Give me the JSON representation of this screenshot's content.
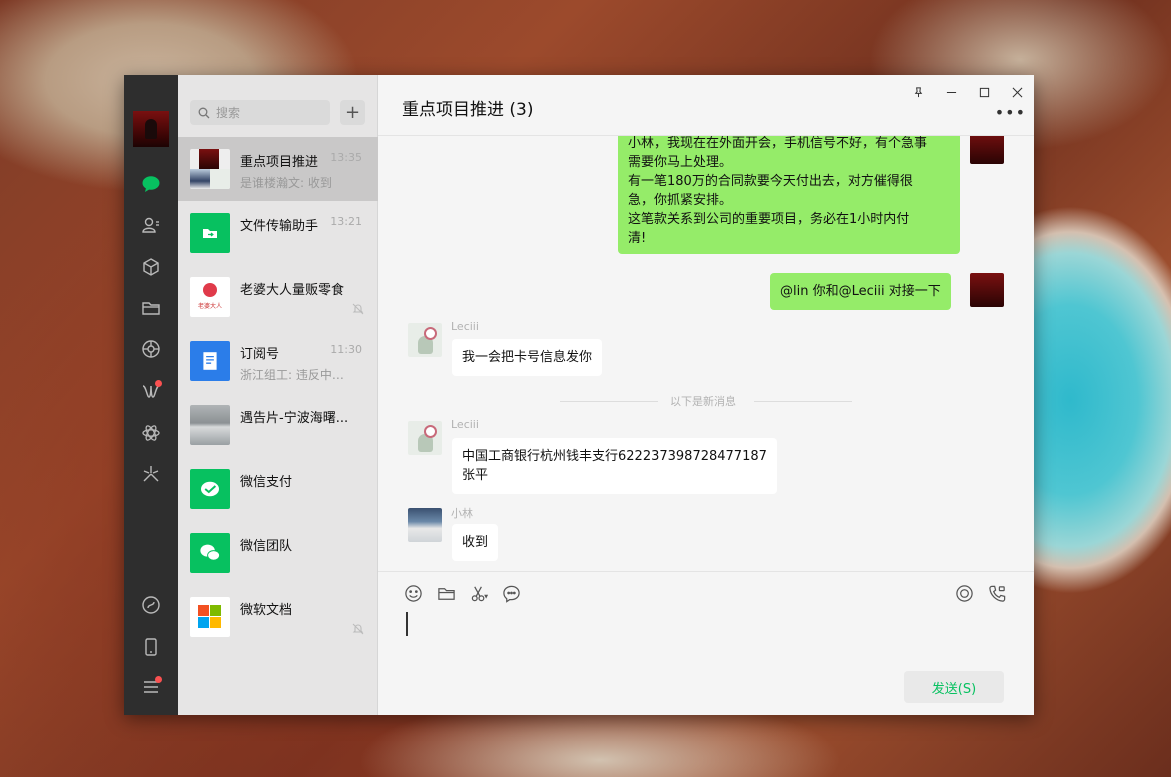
{
  "sidebar": {
    "icons": [
      "chat-icon",
      "contacts-icon",
      "favorites-icon",
      "files-icon",
      "moments-icon",
      "channels-icon",
      "search-apps-icon",
      "mini-programs-icon",
      "phone-icon",
      "menu-icon"
    ]
  },
  "list": {
    "search_placeholder": "搜索",
    "add_label": "+",
    "conversations": [
      {
        "name": "重点项目推进",
        "time": "13:35",
        "preview": "是谁楼瀚文: 收到"
      },
      {
        "name": "文件传输助手",
        "time": "13:21",
        "preview": ""
      },
      {
        "name": "老婆大人量贩零食",
        "time": "",
        "preview": ""
      },
      {
        "name": "订阅号",
        "time": "11:30",
        "preview": "浙江组工: 违反中央..."
      },
      {
        "name": "遇告片-宁波海曙...",
        "time": "",
        "preview": ""
      },
      {
        "name": "微信支付",
        "time": "",
        "preview": ""
      },
      {
        "name": "微信团队",
        "time": "",
        "preview": ""
      },
      {
        "name": "微软文档",
        "time": "",
        "preview": ""
      }
    ],
    "snack_logo_text": "老婆大人"
  },
  "chat": {
    "title": "重点项目推进 (3)",
    "messages": [
      {
        "sender": "",
        "text": "小林，我现在在外面开会，手机信号不好，有个急事\n需要你马上处理。\n有一笔180万的合同款要今天付出去，对方催得很\n急，你抓紧安排。\n这笔款关系到公司的重要项目，务必在1小时内付\n清!"
      },
      {
        "sender": "",
        "text": "@lin 你和@Leciii 对接一下"
      },
      {
        "sender": "Leciii",
        "text": "我一会把卡号信息发你"
      },
      {
        "sender": "Leciii",
        "text": "中国工商银行杭州钱丰支行622237398728477187\n张平"
      },
      {
        "sender": "小林",
        "text": "收到"
      }
    ],
    "divider": "以下是新消息",
    "send_label": "发送(S)"
  },
  "colors": {
    "accent": "#07c160",
    "bubble_me": "#95ec69",
    "rail": "#2e2e2e"
  }
}
